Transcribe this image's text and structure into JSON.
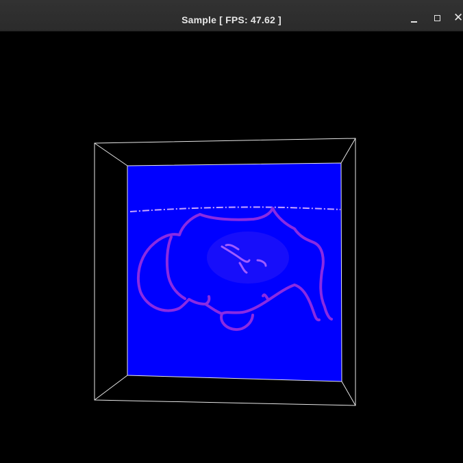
{
  "window": {
    "title": "Sample [ FPS: 47.62 ]",
    "minimize_icon": "minimize-icon",
    "maximize_icon": "maximize-icon",
    "close_icon": "close-icon"
  },
  "viewport": {
    "background_color": "#000000",
    "wireframe_color": "#e8e8e8",
    "slice_color": "#0000ff",
    "contour_color": "#8a2be2",
    "scene": "3D volume wireframe box with a blue rendered slice showing a contour outline"
  }
}
